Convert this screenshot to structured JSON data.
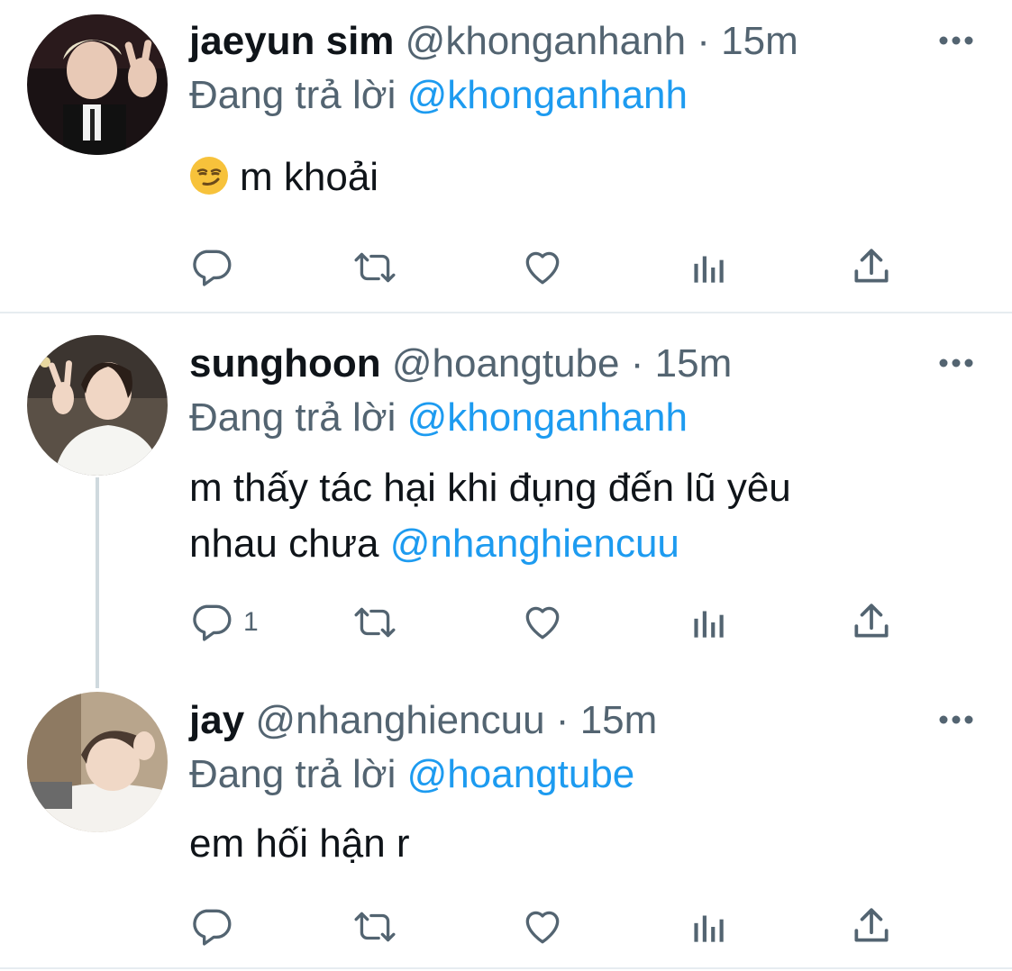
{
  "tweets": [
    {
      "display_name": "jaeyun sim",
      "handle": "@khonganhanh",
      "separator": "·",
      "time": "15m",
      "reply_prefix": "Đang trả lời",
      "reply_to": "@khonganhanh",
      "emoji": "smirking-face",
      "text_plain": "m khoải",
      "reply_count": ""
    },
    {
      "display_name": "sunghoon",
      "handle": "@hoangtube",
      "separator": "·",
      "time": "15m",
      "reply_prefix": "Đang trả lời",
      "reply_to": "@khonganhanh",
      "text_line1": "m thấy tác hại khi đụng đến lũ yêu",
      "text_line2_plain": "nhau chưa",
      "text_line2_mention": "@nhanghiencuu",
      "reply_count": "1"
    },
    {
      "display_name": "jay",
      "handle": "@nhanghiencuu",
      "separator": "·",
      "time": "15m",
      "reply_prefix": "Đang trả lời",
      "reply_to": "@hoangtube",
      "text_plain": "em hối hận r",
      "reply_count": ""
    }
  ],
  "colors": {
    "text": "#0f1419",
    "secondary": "#536471",
    "link": "#1d9bf0",
    "divider": "#e6ecf0",
    "thread_line": "#cfd9de"
  }
}
